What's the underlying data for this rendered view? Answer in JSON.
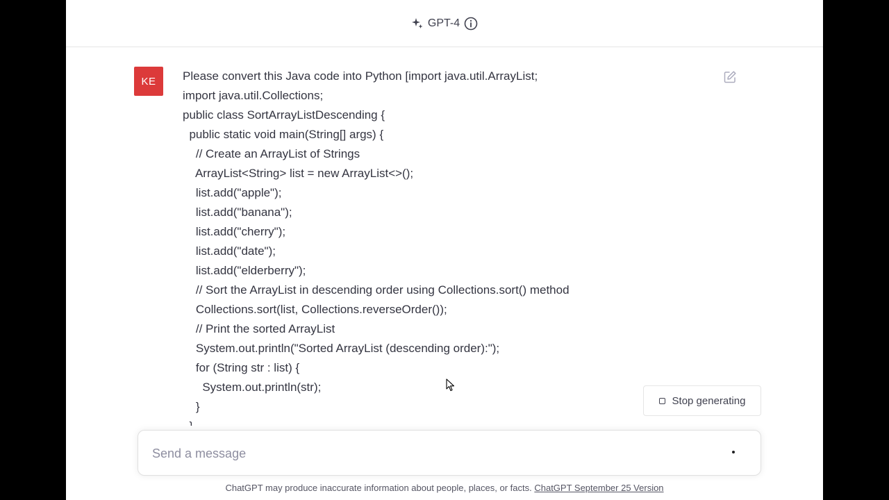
{
  "header": {
    "model_name": "GPT-4",
    "icons": [
      "sparkle-icon",
      "info-icon"
    ]
  },
  "message": {
    "avatar_initials": "KE",
    "lines": [
      "Please convert this Java code into Python [import java.util.ArrayList;",
      "import java.util.Collections;",
      "public class SortArrayListDescending {",
      "  public static void main(String[] args) {",
      "    // Create an ArrayList of Strings",
      "    ArrayList<String> list = new ArrayList<>();",
      "    list.add(\"apple\");",
      "    list.add(\"banana\");",
      "    list.add(\"cherry\");",
      "    list.add(\"date\");",
      "    list.add(\"elderberry\");",
      "    // Sort the ArrayList in descending order using Collections.sort() method",
      "    Collections.sort(list, Collections.reverseOrder());",
      "    // Print the sorted ArrayList",
      "    System.out.println(\"Sorted ArrayList (descending order):\");",
      "    for (String str : list) {",
      "      System.out.println(str);",
      "    }",
      "  }"
    ],
    "edit_icon": "edit-icon"
  },
  "controls": {
    "stop_label": "Stop generating"
  },
  "composer": {
    "placeholder": "Send a message"
  },
  "footer": {
    "disclaimer": "ChatGPT may produce inaccurate information about people, places, or facts. ",
    "version_link": "ChatGPT September 25 Version"
  },
  "colors": {
    "avatar": "#dc3a3a",
    "text": "#343541",
    "muted": "#8e8ea0"
  }
}
